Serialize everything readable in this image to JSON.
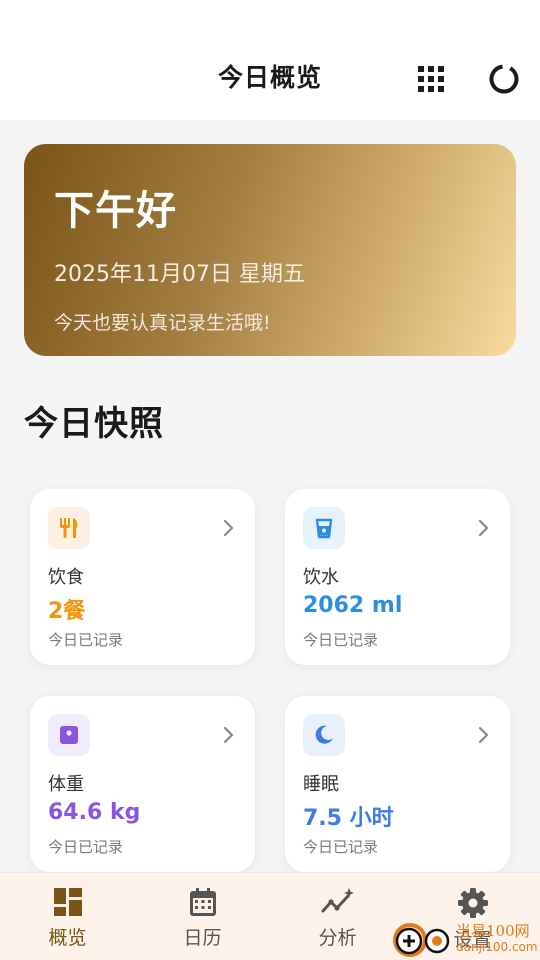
{
  "header": {
    "title": "今日概览",
    "grid_icon": "grid-icon",
    "refresh_icon": "refresh-icon"
  },
  "hero": {
    "greeting": "下午好",
    "date": "2025年11月07日 星期五",
    "motto": "今天也要认真记录生活哦!"
  },
  "section": {
    "title": "今日快照"
  },
  "cards": [
    {
      "label": "饮食",
      "value": "2餐",
      "sub": "今日已记录",
      "icon": "fork-knife-icon",
      "color": "#f0960a",
      "icon_bg": "#fdf0e2"
    },
    {
      "label": "饮水",
      "value": "2062 ml",
      "sub": "今日已记录",
      "icon": "cup-icon",
      "color": "#2f8de3",
      "icon_bg": "#e6f2fc"
    },
    {
      "label": "体重",
      "value": "64.6 kg",
      "sub": "今日已记录",
      "icon": "scale-icon",
      "color": "#8a55e0",
      "icon_bg": "#f1ebfc"
    },
    {
      "label": "睡眠",
      "value": "7.5 小时",
      "sub": "今日已记录",
      "icon": "moon-icon",
      "color": "#3c7ee6",
      "icon_bg": "#e8f0fc"
    }
  ],
  "tabs": [
    {
      "label": "概览",
      "icon": "dashboard-icon",
      "active": true
    },
    {
      "label": "日历",
      "icon": "calendar-icon",
      "active": false
    },
    {
      "label": "分析",
      "icon": "analytics-icon",
      "active": false
    },
    {
      "label": "设置",
      "icon": "gear-icon",
      "active": false
    }
  ],
  "colors": {
    "accent": "#7a5414",
    "hero_start": "#7a5414",
    "hero_end": "#f8dba0",
    "tabbar_bg": "#fdf3ea"
  },
  "watermark": {
    "text": "当易100网",
    "url": "danji100.com"
  }
}
